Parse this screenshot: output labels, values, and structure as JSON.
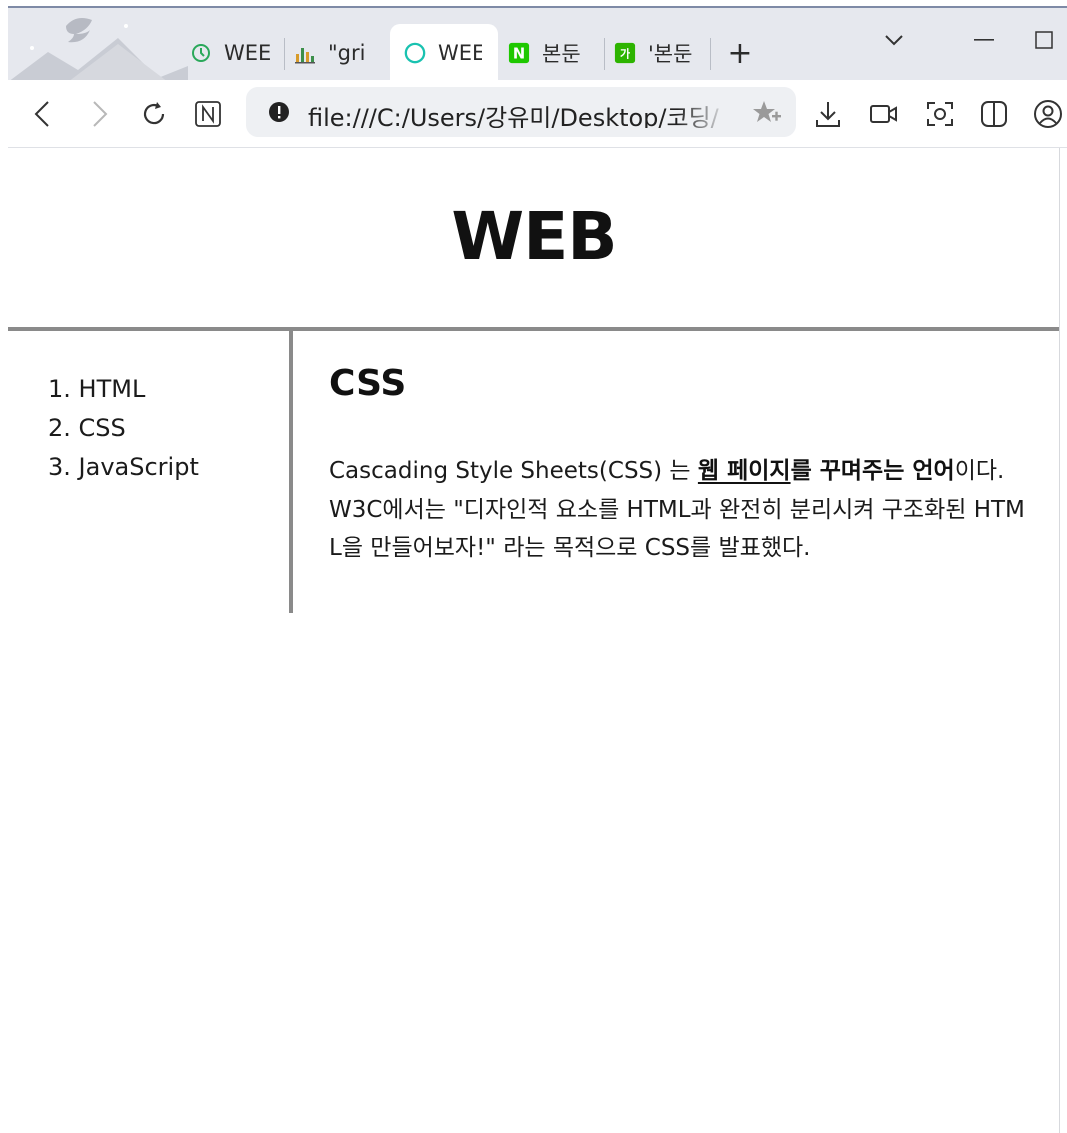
{
  "browser": {
    "tabs": [
      {
        "label": "WEE",
        "icon": "clock-favicon-icon",
        "active": false
      },
      {
        "label": "\"gri",
        "icon": "chart-favicon-icon",
        "active": false
      },
      {
        "label": "WEE",
        "icon": "circle-favicon-icon",
        "active": true
      },
      {
        "label": "본둔",
        "icon": "naver-favicon-icon",
        "active": false
      },
      {
        "label": "'본둔",
        "icon": "dictionary-favicon-icon",
        "active": false
      }
    ],
    "new_tab_label": "+",
    "address": "file:///C:/Users/강유미/Desktop/코딩/"
  },
  "page": {
    "title": "WEB",
    "nav": [
      {
        "number": "1.",
        "label": "HTML"
      },
      {
        "number": "2.",
        "label": "CSS"
      },
      {
        "number": "3.",
        "label": "JavaScript"
      }
    ],
    "article": {
      "heading": "CSS",
      "body": {
        "intro": "Cascading Style Sheets(CSS) 는 ",
        "bold_underlined": "웹 페이지",
        "bold_rest": "를 꾸며주는 언어",
        "rest": "이다. W3C에서는 \"디자인적 요소를 HTML과 완전히 분리시켜 구조화된 HTML을 만들어보자!\" 라는 목적으로 CSS를 발표했다."
      }
    }
  },
  "colors": {
    "rule": "#8a8a8a",
    "titlebar": "#e6e8ee",
    "omnibox": "#eef0f3"
  }
}
